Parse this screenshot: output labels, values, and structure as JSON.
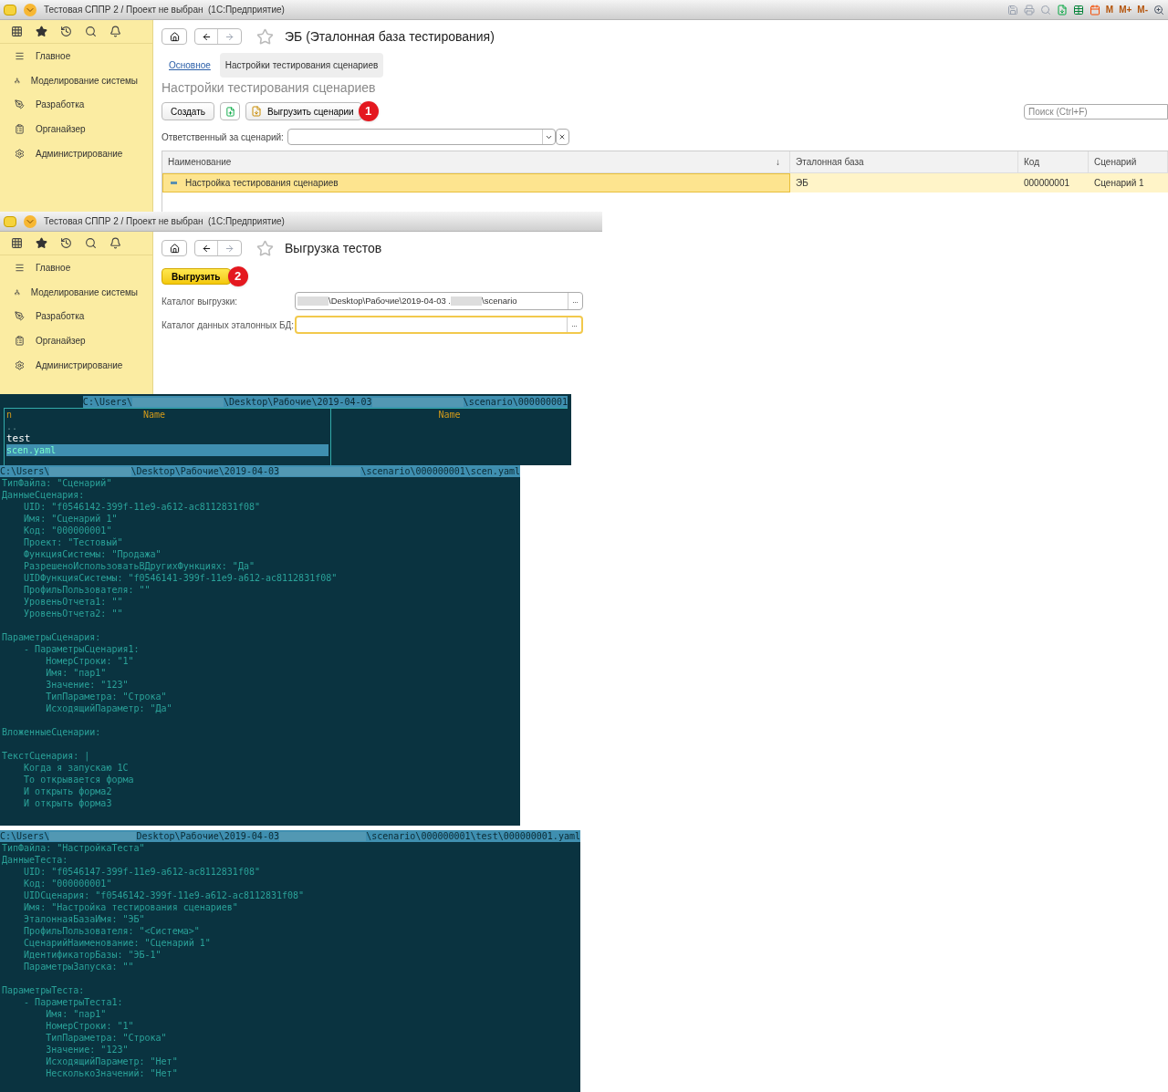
{
  "window_1": {
    "title": "Тестовая СППР 2 / Проект не выбран  (1С:Предприятие)",
    "title_tools": [
      "M",
      "M+",
      "M-"
    ],
    "sidebar": [
      "Главное",
      "Моделирование системы",
      "Разработка",
      "Органайзер",
      "Администрирование"
    ],
    "page_title": "ЭБ (Эталонная база тестирования)",
    "tabs": [
      {
        "label": "Основное",
        "selected": false
      },
      {
        "label": "Настройки тестирования сценариев",
        "selected": true
      }
    ],
    "section_title": "Настройки тестирования сценариев",
    "buttons": {
      "create": "Создать",
      "export": "Выгрузить сценарии",
      "badge": "1"
    },
    "search": {
      "placeholder": "Поиск (Ctrl+F)"
    },
    "filter": {
      "label": "Ответственный за сценарий:"
    },
    "table": {
      "columns": [
        "Наименование",
        "Эталонная база",
        "Код",
        "Сценарий"
      ],
      "sort_mark": "↓",
      "rows": [
        {
          "cells": [
            "Настройка тестирования сценариев",
            "ЭБ",
            "000000001",
            "Сценарий 1"
          ],
          "selected": true
        }
      ]
    }
  },
  "window_2": {
    "title": "Тестовая СППР 2 / Проект не выбран  (1С:Предприятие)",
    "sidebar": [
      "Главное",
      "Моделирование системы",
      "Разработка",
      "Органайзер",
      "Администрирование"
    ],
    "page_title": "Выгрузка тестов",
    "button": "Выгрузить",
    "badge": "2",
    "fields": [
      {
        "label": "Каталог выгрузки:",
        "focused": false,
        "value_parts": [
          {
            "kind": "redacted"
          },
          {
            "kind": "text",
            "text": "\\Desktop\\Рабочие\\2019-04-03 ."
          },
          {
            "kind": "redacted"
          },
          {
            "kind": "text",
            "text": "\\scenario"
          }
        ]
      },
      {
        "label": "Каталог данных эталонных БД:",
        "focused": true
      }
    ],
    "browse_labels": [
      "...",
      "..."
    ]
  },
  "file_panel": {
    "path": [
      {
        "kind": "text",
        "text": "C:\\Users\\"
      },
      {
        "kind": "redacted"
      },
      {
        "kind": "text",
        "text": "\\Desktop\\Рабочие\\2019-04-03"
      },
      {
        "kind": "redacted"
      },
      {
        "kind": "text",
        "text": "\\scenario\\000000001"
      }
    ],
    "left_columns": [
      "n",
      "Name"
    ],
    "right_columns": [
      "Name"
    ],
    "entries": [
      {
        "name": "..",
        "kind": "parent",
        "selected": false
      },
      {
        "name": "test",
        "kind": "folder",
        "selected": false
      },
      {
        "name": "scen.yaml",
        "kind": "file",
        "selected": true
      }
    ]
  },
  "editors": [
    {
      "path": [
        {
          "kind": "text",
          "text": "C:\\Users\\"
        },
        {
          "kind": "redacted"
        },
        {
          "kind": "text",
          "text": "\\Desktop\\Рабочие\\2019-04-03"
        },
        {
          "kind": "redacted"
        },
        {
          "kind": "text",
          "text": "\\scenario\\000000001\\scen.yaml"
        }
      ],
      "blocks": [
        [
          "ТипФайла: \"Сценарий\"",
          "ДанныеСценария:",
          "    UID: \"f0546142-399f-11e9-a612-ac8112831f08\"",
          "    Имя: \"Сценарий 1\"",
          "    Код: \"000000001\"",
          "    Проект: \"Тестовый\"",
          "    ФункцияСистемы: \"Продажа\"",
          "    РазрешеноИспользоватьВДругихФункциях: \"Да\"",
          "    UIDФункцияСистемы: \"f0546141-399f-11e9-a612-ac8112831f08\"",
          "    ПрофильПользователя: \"\"",
          "    УровеньОтчета1: \"\"",
          "    УровеньОтчета2: \"\""
        ],
        [
          "ПараметрыСценария:",
          "    - ПараметрыСценария1:",
          "        НомерСтроки: \"1\"",
          "        Имя: \"пар1\"",
          "        Значение: \"123\"",
          "        ТипПараметра: \"Строка\"",
          "        ИсходящийПараметр: \"Да\""
        ],
        [
          "ВложенныеСценарии:"
        ],
        [
          "ТекстСценария: |",
          "    Когда я запускаю 1С",
          "    То открывается форма",
          "    И открыть форма2",
          "    И открыть форма3"
        ]
      ]
    },
    {
      "path": [
        {
          "kind": "text",
          "text": "C:\\Users\\"
        },
        {
          "kind": "redacted"
        },
        {
          "kind": "text",
          "text": "Desktop\\Рабочие\\2019-04-03"
        },
        {
          "kind": "redacted"
        },
        {
          "kind": "text",
          "text": "\\scenario\\000000001\\test\\000000001.yaml"
        }
      ],
      "blocks": [
        [
          "ТипФайла: \"НастройкаТеста\"",
          "ДанныеТеста:",
          "    UID: \"f0546147-399f-11e9-a612-ac8112831f08\"",
          "    Код: \"000000001\"",
          "    UIDСценария: \"f0546142-399f-11e9-a612-ac8112831f08\"",
          "    Имя: \"Настройка тестирования сценариев\"",
          "    ЭталоннаяБазаИмя: \"ЭБ\"",
          "    ПрофильПользователя: \"<Система>\"",
          "    СценарийНаименование: \"Сценарий 1\"",
          "    ИдентификаторБазы: \"ЭБ-1\"",
          "    ПараметрыЗапуска: \"\""
        ],
        [
          "ПараметрыТеста:",
          "    - ПараметрыТеста1:",
          "        Имя: \"пар1\"",
          "        НомерСтроки: \"1\"",
          "        ТипПараметра: \"Строка\"",
          "        Значение: \"123\"",
          "        ИсходящийПараметр: \"Нет\"",
          "        НесколькоЗначений: \"Нет\""
        ]
      ]
    }
  ]
}
